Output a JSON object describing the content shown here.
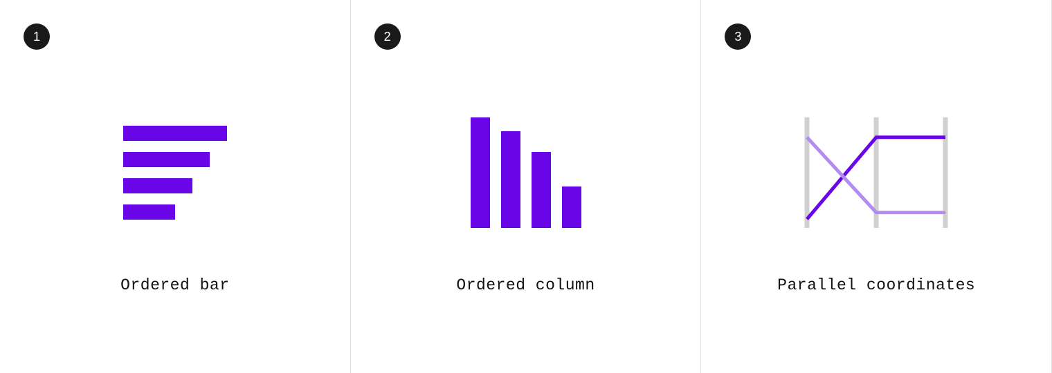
{
  "panels": [
    {
      "number": "1",
      "label": "Ordered bar"
    },
    {
      "number": "2",
      "label": "Ordered column"
    },
    {
      "number": "3",
      "label": "Parallel coordinates"
    }
  ],
  "colors": {
    "accent": "#6906e8",
    "accent_light": "#b28cf0",
    "axis": "#d0d0d0",
    "badge_bg": "#1a1a1a"
  },
  "chart_data": [
    {
      "type": "bar",
      "orientation": "horizontal",
      "title": "Ordered bar",
      "values": [
        150,
        125,
        100,
        75
      ]
    },
    {
      "type": "bar",
      "orientation": "vertical",
      "title": "Ordered column",
      "values": [
        160,
        140,
        110,
        60
      ]
    },
    {
      "type": "parallel_coordinates",
      "title": "Parallel coordinates",
      "axes": [
        0,
        100,
        200
      ],
      "y_range": [
        0,
        100
      ],
      "series": [
        {
          "name": "dark",
          "color": "#6906e8",
          "values": [
            8,
            82,
            82
          ]
        },
        {
          "name": "light",
          "color": "#b28cf0",
          "values": [
            82,
            14,
            14
          ]
        }
      ]
    }
  ]
}
